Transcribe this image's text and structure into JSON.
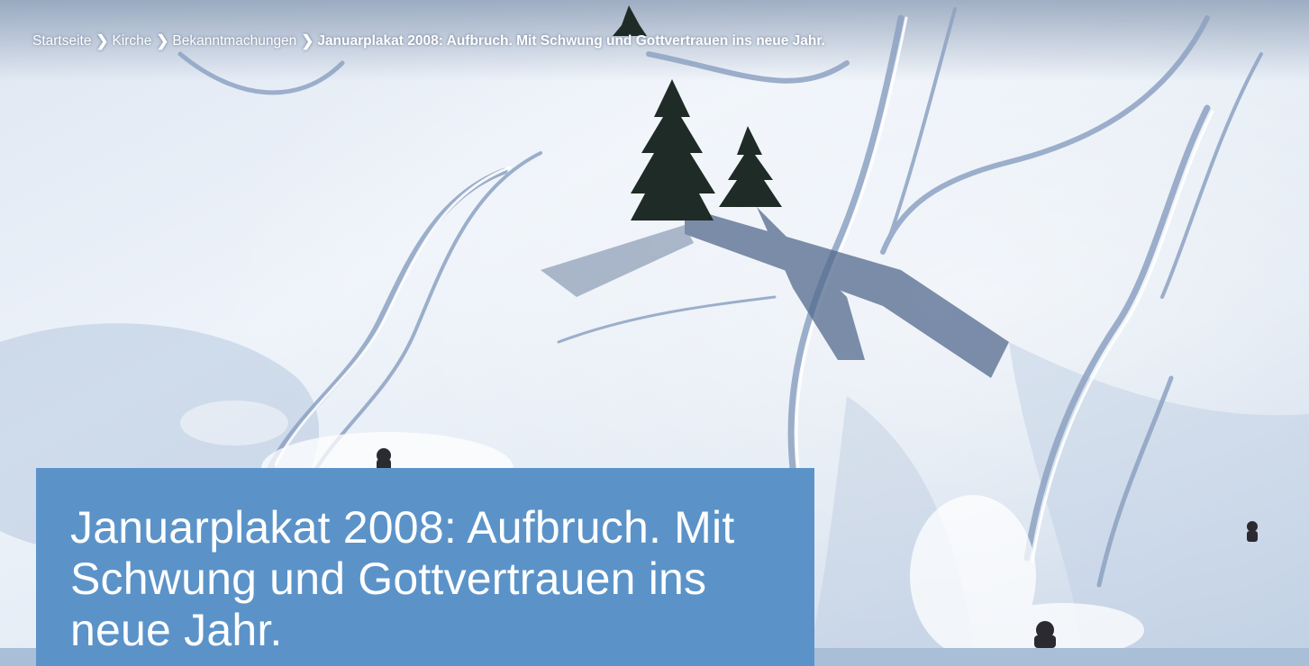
{
  "breadcrumb": {
    "items": [
      {
        "label": "Startseite"
      },
      {
        "label": "Kirche"
      },
      {
        "label": "Bekanntmachungen"
      },
      {
        "label": "Januarplakat 2008: Aufbruch. Mit Schwung und Gottvertrauen ins neue Jahr."
      }
    ],
    "separator_icon": "chevron-right-icon"
  },
  "hero": {
    "image_icon": "snow-slope-with-ski-tracks-photo",
    "title": "Januarplakat 2008: Aufbruch. Mit Schwung und Gottvertrauen ins neue Jahr."
  },
  "colors": {
    "title_box": "#5b93c9",
    "text": "#ffffff",
    "snow_light": "#eef3fa",
    "snow_shadow": "#9fb3cf"
  }
}
